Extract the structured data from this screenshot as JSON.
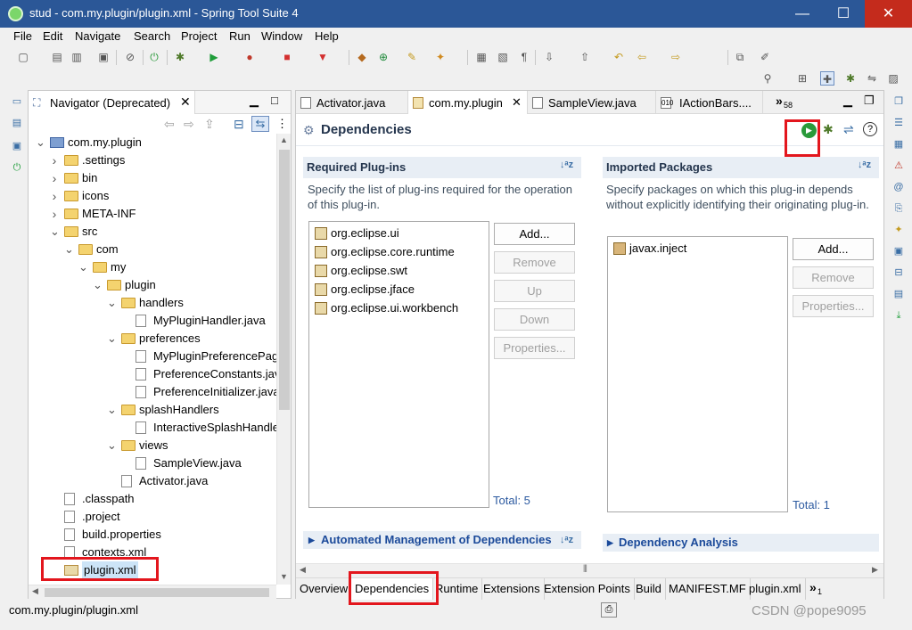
{
  "window": {
    "title": "stud - com.my.plugin/plugin.xml - Spring Tool Suite 4",
    "minimize_glyph": "—",
    "maximize_glyph": "☐",
    "close_glyph": "✕"
  },
  "menu": [
    "File",
    "Edit",
    "Navigate",
    "Search",
    "Project",
    "Run",
    "Window",
    "Help"
  ],
  "navigator": {
    "title": "Navigator (Deprecated)",
    "tree": [
      {
        "label": "com.my.plugin",
        "depth": 0,
        "expanded": true,
        "icon": "project-icon"
      },
      {
        "label": ".settings",
        "depth": 1,
        "expanded": false,
        "icon": "folder-icon"
      },
      {
        "label": "bin",
        "depth": 1,
        "expanded": false,
        "icon": "folder-icon"
      },
      {
        "label": "icons",
        "depth": 1,
        "expanded": false,
        "icon": "folder-icon"
      },
      {
        "label": "META-INF",
        "depth": 1,
        "expanded": false,
        "icon": "folder-icon"
      },
      {
        "label": "src",
        "depth": 1,
        "expanded": true,
        "icon": "folder-icon"
      },
      {
        "label": "com",
        "depth": 2,
        "expanded": true,
        "icon": "folder-icon"
      },
      {
        "label": "my",
        "depth": 3,
        "expanded": true,
        "icon": "folder-icon"
      },
      {
        "label": "plugin",
        "depth": 4,
        "expanded": true,
        "icon": "folder-icon"
      },
      {
        "label": "handlers",
        "depth": 5,
        "expanded": true,
        "icon": "folder-icon"
      },
      {
        "label": "MyPluginHandler.java",
        "depth": 6,
        "icon": "java-file-icon"
      },
      {
        "label": "preferences",
        "depth": 5,
        "expanded": true,
        "icon": "folder-icon"
      },
      {
        "label": "MyPluginPreferencePage",
        "depth": 6,
        "icon": "java-file-icon"
      },
      {
        "label": "PreferenceConstants.java",
        "depth": 6,
        "icon": "java-file-icon"
      },
      {
        "label": "PreferenceInitializer.java",
        "depth": 6,
        "icon": "java-file-icon"
      },
      {
        "label": "splashHandlers",
        "depth": 5,
        "expanded": true,
        "icon": "folder-icon"
      },
      {
        "label": "InteractiveSplashHandler",
        "depth": 6,
        "icon": "java-file-icon"
      },
      {
        "label": "views",
        "depth": 5,
        "expanded": true,
        "icon": "folder-icon"
      },
      {
        "label": "SampleView.java",
        "depth": 6,
        "icon": "java-file-icon"
      },
      {
        "label": "Activator.java",
        "depth": 5,
        "icon": "java-file-icon"
      },
      {
        "label": ".classpath",
        "depth": 1,
        "icon": "xml-file-icon"
      },
      {
        "label": ".project",
        "depth": 1,
        "icon": "xml-file-icon"
      },
      {
        "label": "build.properties",
        "depth": 1,
        "icon": "properties-file-icon"
      },
      {
        "label": "contexts.xml",
        "depth": 1,
        "icon": "file-icon"
      },
      {
        "label": "plugin.xml",
        "depth": 1,
        "icon": "plugin-file-icon",
        "selected": true
      }
    ]
  },
  "editor": {
    "tabs": [
      {
        "label": "Activator.java",
        "active": false
      },
      {
        "label": "com.my.plugin",
        "active": true
      },
      {
        "label": "SampleView.java",
        "active": false
      },
      {
        "label": "IActionBars....",
        "active": false
      }
    ],
    "tab_overflow": "»",
    "tab_overflow_count": "58",
    "form_title": "Dependencies",
    "required": {
      "title": "Required Plug-ins",
      "description": "Specify the list of plug-ins required for the operation of this plug-in.",
      "items": [
        "org.eclipse.ui",
        "org.eclipse.core.runtime",
        "org.eclipse.swt",
        "org.eclipse.jface",
        "org.eclipse.ui.workbench"
      ],
      "buttons": {
        "add": "Add...",
        "remove": "Remove",
        "up": "Up",
        "down": "Down",
        "properties": "Properties..."
      },
      "total": "Total: 5"
    },
    "imported": {
      "title": "Imported Packages",
      "description": "Specify packages on which this plug-in depends without explicitly identifying their originating plug-in.",
      "items": [
        "javax.inject"
      ],
      "buttons": {
        "add": "Add...",
        "remove": "Remove",
        "properties": "Properties..."
      },
      "total": "Total: 1"
    },
    "automated": "Automated Management of Dependencies",
    "analysis": "Dependency Analysis",
    "bottom_tabs": [
      "Overview",
      "Dependencies",
      "Runtime",
      "Extensions",
      "Extension Points",
      "Build",
      "MANIFEST.MF",
      "plugin.xml"
    ],
    "bottom_overflow": "»",
    "bottom_overflow_count": "1",
    "active_bottom_tab": "Dependencies"
  },
  "status": {
    "path": "com.my.plugin/plugin.xml"
  },
  "watermark": "CSDN @pope9095",
  "colors": {
    "titlebar": "#2b5797",
    "highlight": "#e3161d",
    "section_header": "#e8eef5",
    "link": "#1b4a9a"
  }
}
